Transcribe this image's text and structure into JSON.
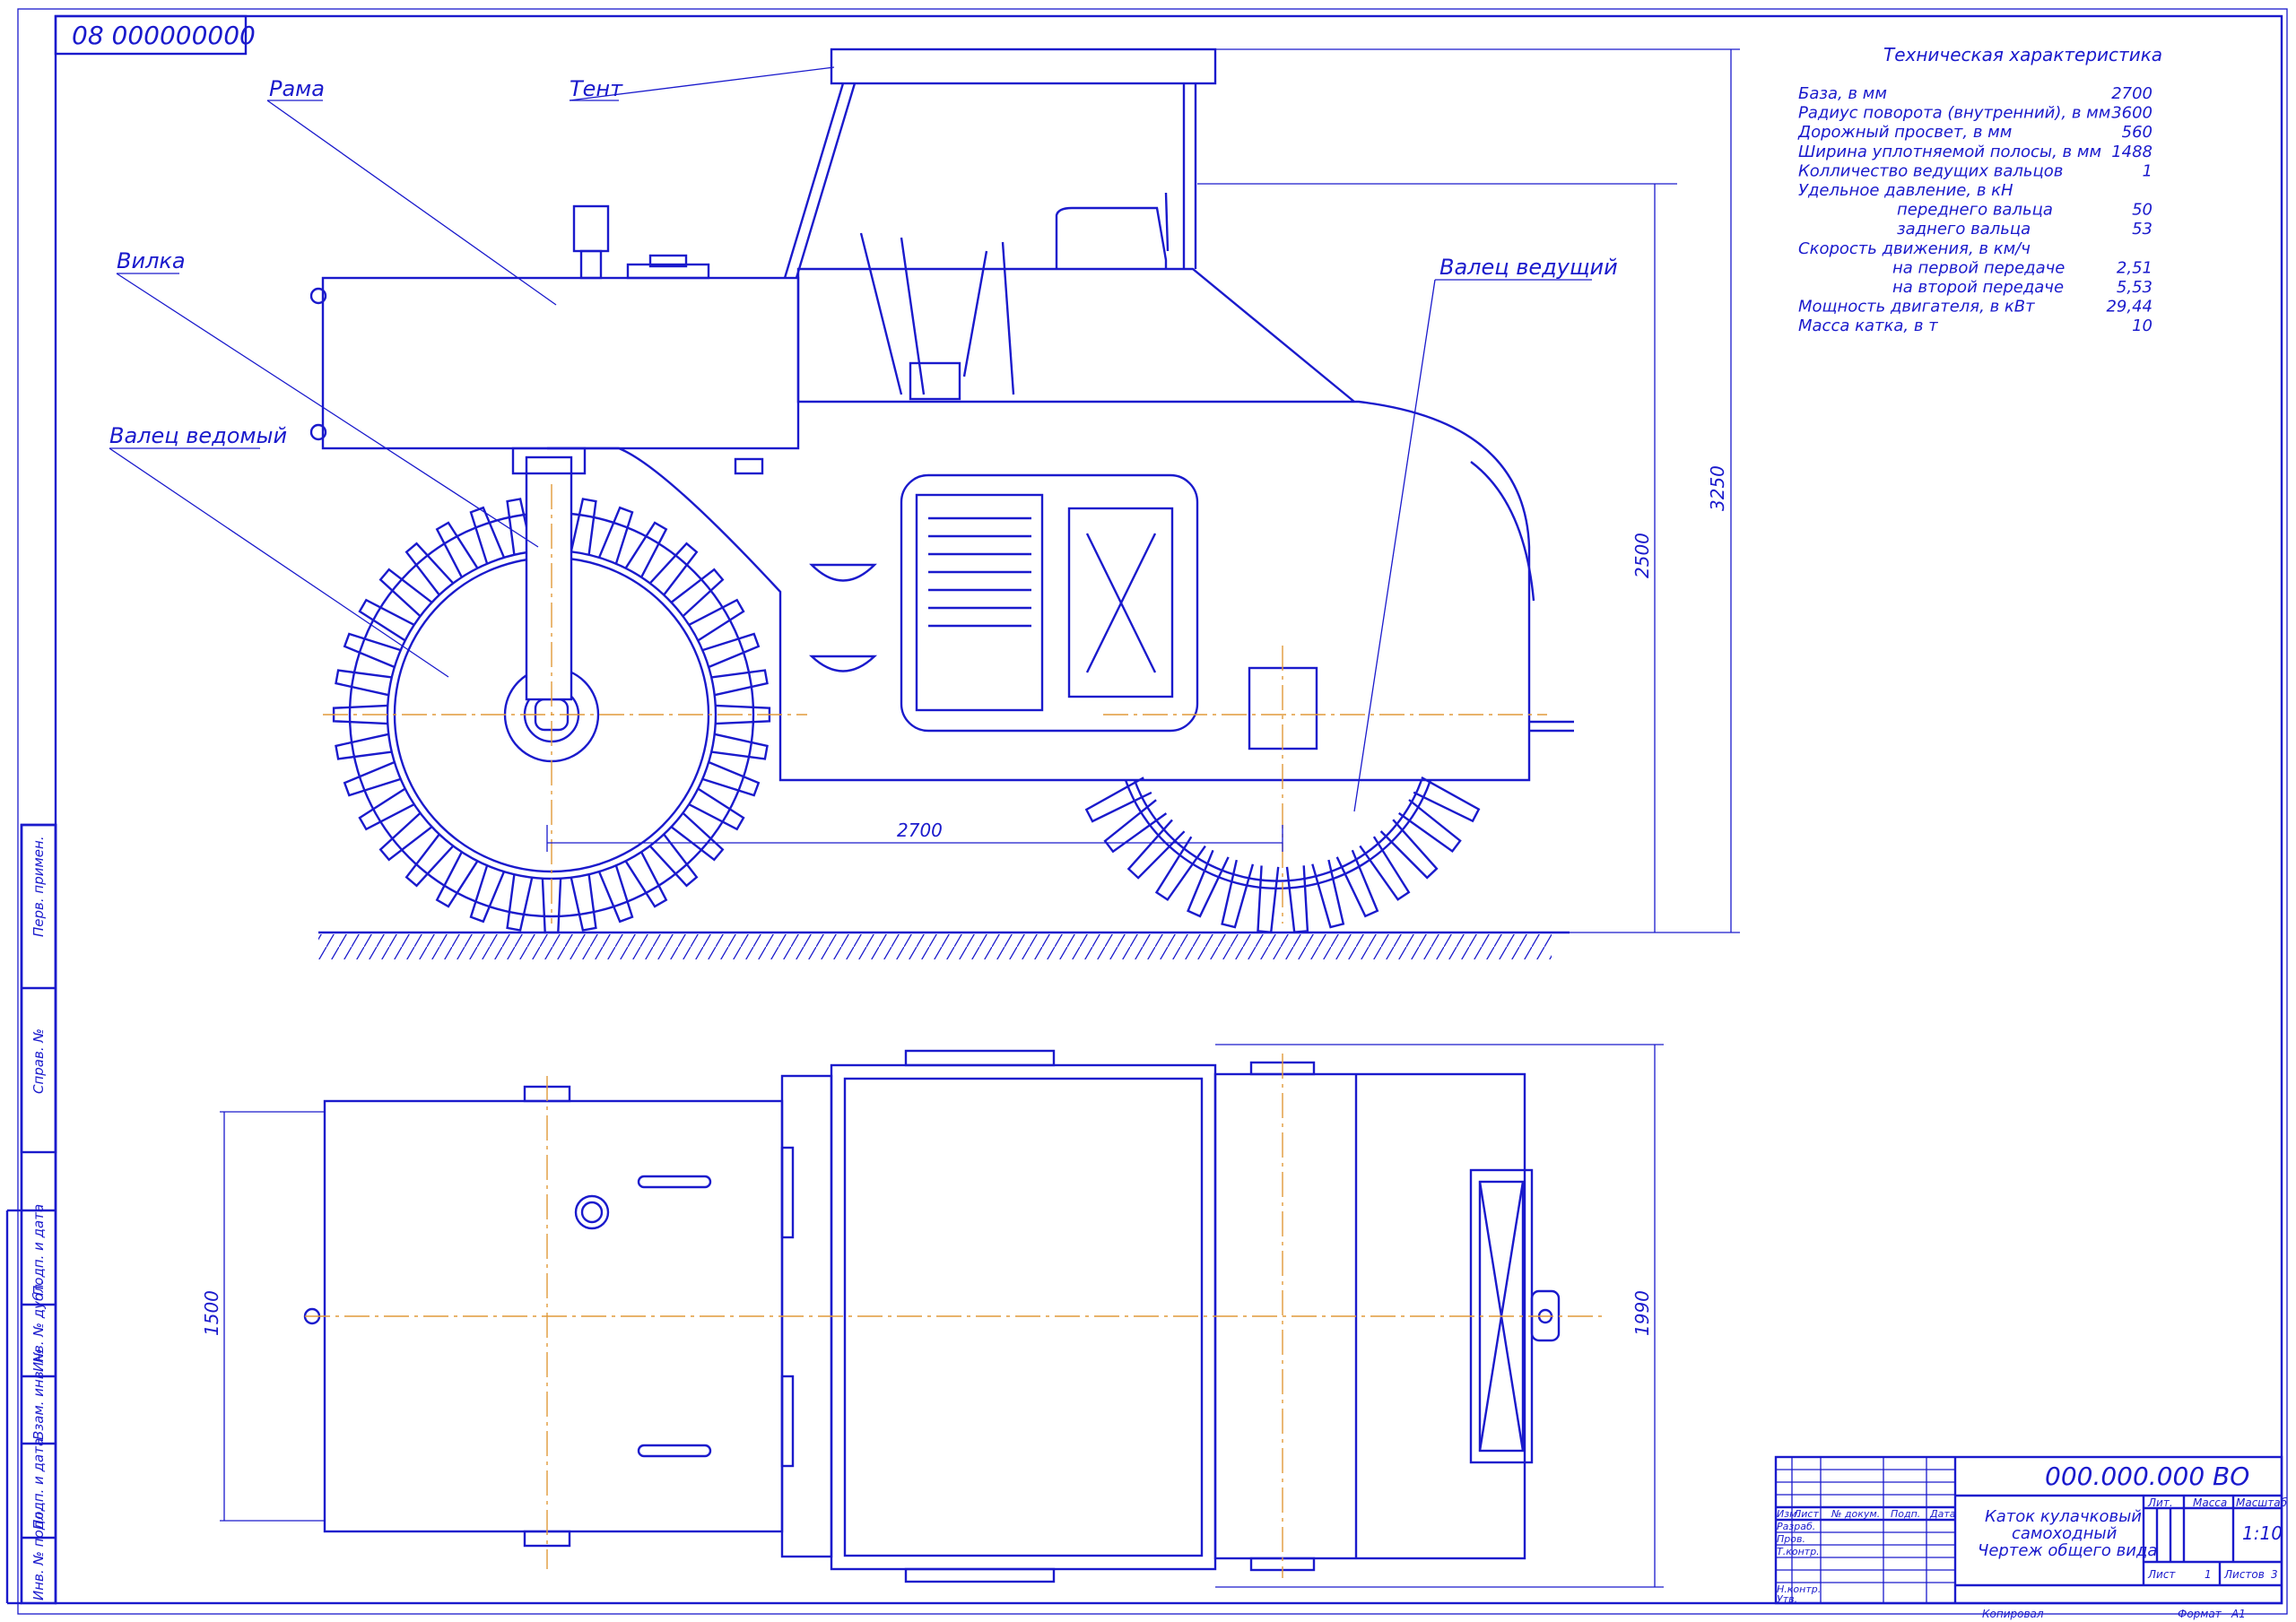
{
  "colors": {
    "line": "#1a1acc",
    "axis": "#e09a3a",
    "paper": "#ffffff"
  },
  "top_stamp": "08 000000000",
  "callouts": {
    "frame": "Рама",
    "canopy": "Тент",
    "fork": "Вилка",
    "driven_roller": "Валец ведомый",
    "drive_roller": "Валец ведущий"
  },
  "dimensions": {
    "wheelbase": "2700",
    "total_height": "3250",
    "height_to_seat": "2500",
    "width_total": "1990",
    "roller_width": "1500"
  },
  "specs": {
    "title": "Техническая характеристика",
    "rows": [
      {
        "label": "База, в мм",
        "value": "2700",
        "indent": 0
      },
      {
        "label": "Радиус поворота (внутренний), в мм",
        "value": "3600",
        "indent": 0
      },
      {
        "label": "Дорожный просвет, в мм",
        "value": "560",
        "indent": 0
      },
      {
        "label": "Ширина уплотняемой полосы, в мм",
        "value": "1488",
        "indent": 0
      },
      {
        "label": "Колличество ведущих вальцов",
        "value": "1",
        "indent": 0
      },
      {
        "label": "Удельное давление, в кН",
        "value": "",
        "indent": 0
      },
      {
        "label": "переднего вальца",
        "value": "50",
        "indent": 2
      },
      {
        "label": "заднего вальца",
        "value": "53",
        "indent": 2
      },
      {
        "label": "Скорость движения, в км/ч",
        "value": "",
        "indent": 0
      },
      {
        "label": "на первой передаче",
        "value": "2,51",
        "indent": 1
      },
      {
        "label": "на второй передаче",
        "value": "5,53",
        "indent": 1
      },
      {
        "label": "Мощность двигателя, в кВт",
        "value": "29,44",
        "indent": 0
      },
      {
        "label": "Масса катка, в т",
        "value": "10",
        "indent": 0
      }
    ]
  },
  "side_stamps": [
    "Перв. примен.",
    "Справ. №",
    "Подп. и дата",
    "Инв. № дубл.",
    "Взам. инв. №",
    "Подп. и дата",
    "Инв. № подл."
  ],
  "title_block": {
    "designation": "000.000.000 ВО",
    "name_line1": "Каток кулачковый",
    "name_line2": "самоходный",
    "name_line3": "Чертеж общего вида",
    "col_headers": [
      "Изм.",
      "Лист",
      "№ докум.",
      "Подп.",
      "Дата"
    ],
    "roles": [
      "Разраб.",
      "Пров.",
      "Т.контр.",
      "Н.контр.",
      "Утв."
    ],
    "lit": "Лит.",
    "mass": "Масса",
    "scale_label": "Масштаб",
    "scale": "1:10",
    "sheet_label": "Лист",
    "sheet_no": "1",
    "sheets_label": "Листов",
    "sheets_no": "3",
    "copied": "Копировал",
    "format_label": "Формат",
    "format": "А1"
  }
}
